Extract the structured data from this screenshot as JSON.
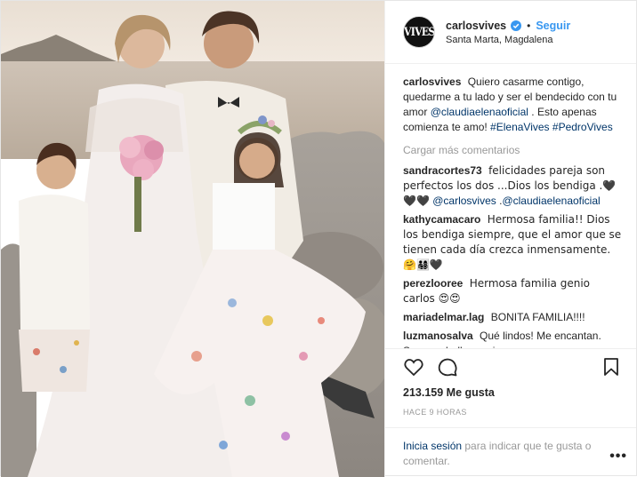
{
  "header": {
    "username": "carlosvives",
    "follow_label": "Seguir",
    "separator": "•",
    "location": "Santa Marta, Magdalena",
    "avatar_text": "VIVES",
    "verified_color": "#3897f0"
  },
  "caption": {
    "username": "carlosvives",
    "text_1": " Quiero casarme contigo, quedarme a tu lado y ser el bendecido con tu amor ",
    "mention": "@claudiaelenaoficial",
    "text_2": " . Esto apenas comienza te amo! ",
    "hashtag_1": "#ElenaVives",
    "hashtag_2": "#PedroVives"
  },
  "load_more_label": "Cargar más comentarios",
  "comments": [
    {
      "user": "sandracortes73",
      "text": "felicidades pareja son perfectos los dos ...Dios los bendiga .🖤🖤🖤",
      "mention": "@carlosvives",
      "text_after": " .",
      "mention_2": "@claudiaelenaoficial"
    },
    {
      "user": "kathycamacaro",
      "text": "Hermosa familia!! Dios los bendiga siempre, que el amor que se tienen cada día crezca inmensamente. 🤗👨‍👩‍👧‍👦🖤"
    },
    {
      "user": "perezlooree",
      "text": "Hermosa familia genio carlos 😍😍"
    },
    {
      "user": "mariadelmar.lag",
      "text": "BONITA FAMILIA!!!!"
    },
    {
      "user": "luzmanosalva",
      "text": "Qué lindos! Me encantan. Son una bella pareja"
    }
  ],
  "actions": {
    "like_icon": "heart-icon",
    "comment_icon": "comment-icon",
    "save_icon": "bookmark-icon"
  },
  "likes_label": "213.159 Me gusta",
  "time_ago": "HACE 9 HORAS",
  "login": {
    "link_label": "Inicia sesión",
    "text": " para indicar que te gusta o comentar.",
    "more_label": "•••"
  },
  "colors": {
    "link_blue": "#3897f0",
    "mention_blue": "#003569",
    "muted_gray": "#999999"
  }
}
